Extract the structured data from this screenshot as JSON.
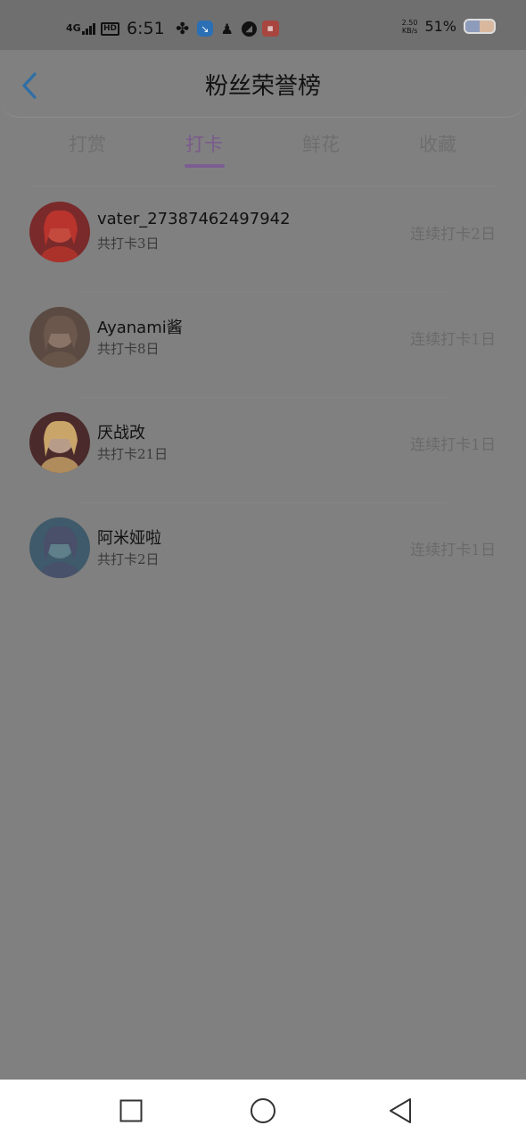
{
  "status_bar": {
    "network": "4G",
    "hd": "HD",
    "time": "6:51",
    "speed_value": "2.50",
    "speed_unit": "KB/s",
    "battery_percent": "51%",
    "battery_level": 0.51
  },
  "header": {
    "title": "粉丝荣誉榜"
  },
  "tabs": [
    {
      "label": "打赏",
      "active": false
    },
    {
      "label": "打卡",
      "active": true
    },
    {
      "label": "鲜花",
      "active": false
    },
    {
      "label": "收藏",
      "active": false
    }
  ],
  "fans": [
    {
      "name": "vater_27387462497942",
      "total": "共打卡3日",
      "streak": "连续打卡2日",
      "avatar": {
        "bg": "#7a2a2a",
        "fg": "#c44a3e",
        "hair": "#b8342c"
      }
    },
    {
      "name": "Ayanami酱",
      "total": "共打卡8日",
      "streak": "连续打卡1日",
      "avatar": {
        "bg": "#5b4a42",
        "fg": "#8a7468",
        "hair": "#6b574c"
      }
    },
    {
      "name": "厌战改",
      "total": "共打卡21日",
      "streak": "连续打卡1日",
      "avatar": {
        "bg": "#4a2a2a",
        "fg": "#b89c8a",
        "hair": "#c9a56a"
      }
    },
    {
      "name": "阿米娅啦",
      "total": "共打卡2日",
      "streak": "连续打卡1日",
      "avatar": {
        "bg": "#3f5a6a",
        "fg": "#5f7f8a",
        "hair": "#4a4f6a"
      }
    }
  ],
  "colors": {
    "overlay": "#808080",
    "active_tab": "#7a5a8c",
    "back_arrow": "#2f6ea6"
  }
}
